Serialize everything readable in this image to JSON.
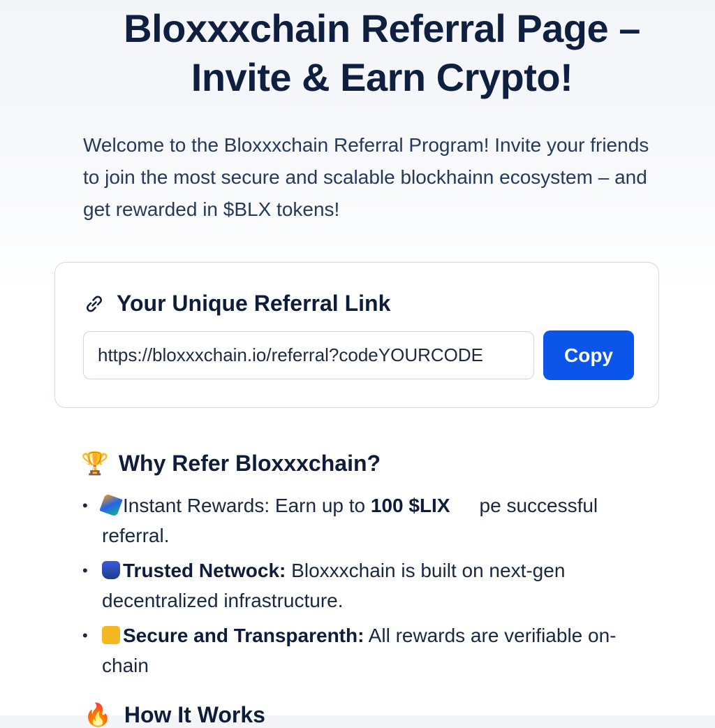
{
  "page": {
    "title_line1": "Bloxxxchain Referral Page –",
    "title_line2": "Invite & Earn Crypto!",
    "intro": "Welcome to the Bloxxxchain Referral Program! Invite your friends to join the most secure and scalable blockhainn ecosystem – and get rewarded in $BLX tokens!"
  },
  "referral": {
    "heading": "Your Unique Referral Link",
    "link_value": "https://bloxxxchain.io/referral?codeYOURCODE",
    "copy_label": "Copy",
    "heading_icon": "link-icon",
    "accent_color": "#0b55ea"
  },
  "why": {
    "heading": "Why Refer Bloxxxchain?",
    "heading_icon": "🏆",
    "items": [
      {
        "icon": "rewards-icon",
        "label": "Instant Rewards:",
        "text_before": "Earn up to",
        "highlight": "100 $LIX",
        "text_after": "pe successful referral."
      },
      {
        "icon": "network-icon",
        "label": "Trusted Netwock:",
        "text": "Bloxxxchain is built on next-gen decentralized infrastructure."
      },
      {
        "icon": "lock-icon",
        "label": "Secure and Transparenth:",
        "text": "All rewards are verifiable on-chain"
      }
    ]
  },
  "how": {
    "heading": "How It Works",
    "heading_icon": "🔥"
  }
}
